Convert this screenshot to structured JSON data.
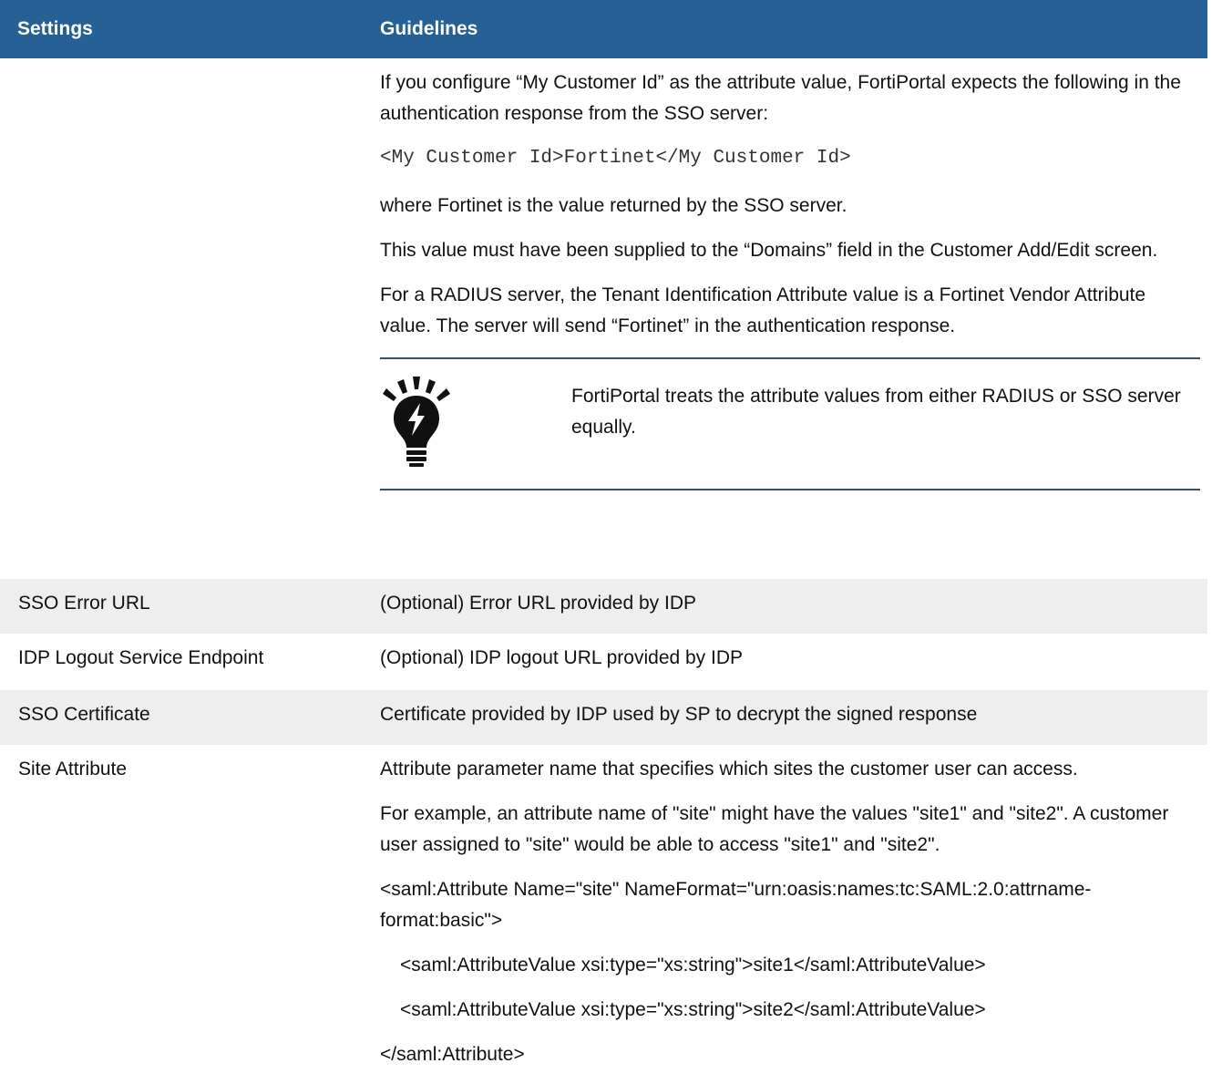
{
  "headers": {
    "settings": "Settings",
    "guidelines": "Guidelines"
  },
  "tenant_row": {
    "para1": "If you configure “My Customer Id” as the attribute value, FortiPortal expects the following in the authentication response from the SSO server:",
    "code": "<My Customer Id>Fortinet</My Customer Id>",
    "para2": "where Fortinet is the value returned by the SSO server.",
    "para3": "This value must have been supplied to the “Domains” field in the Customer Add/Edit screen.",
    "para4": "For a RADIUS server, the Tenant Identification Attribute value is a Fortinet Vendor Attribute value. The server will send “Fortinet” in the authentication response.",
    "note_icon": "lightbulb-tip-icon",
    "note": "FortiPortal treats the attribute values from either RADIUS or SSO server equally."
  },
  "rows": [
    {
      "setting": "SSO Error URL",
      "guideline": "(Optional) Error URL provided by IDP"
    },
    {
      "setting": "IDP Logout Service Endpoint",
      "guideline": "(Optional) IDP logout URL provided by IDP"
    },
    {
      "setting": "SSO Certificate",
      "guideline": "Certificate provided by IDP used by SP to decrypt the signed response"
    }
  ],
  "site_row": {
    "setting": "Site Attribute",
    "para1": "Attribute parameter name that specifies which sites the customer user can access.",
    "para2": "For example, an attribute name of \"site\" might have the values \"site1\" and \"site2\". A customer user assigned to \"site\" would be able to access \"site1\" and \"site2\".",
    "xml1": "<saml:Attribute Name=\"site\" NameFormat=\"urn:oasis:names:tc:SAML:2.0:attrname-format:basic\">",
    "xml2": "<saml:AttributeValue xsi:type=\"xs:string\">site1</saml:AttributeValue>",
    "xml3": "<saml:AttributeValue xsi:type=\"xs:string\">site2</saml:AttributeValue>",
    "xml4": "</saml:Attribute>"
  }
}
